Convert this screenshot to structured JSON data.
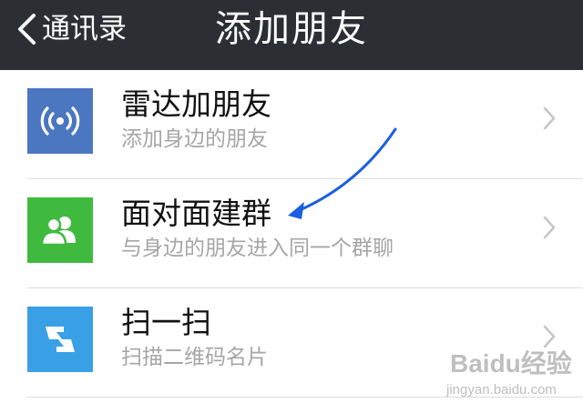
{
  "header": {
    "back_label": "通讯录",
    "title": "添加朋友"
  },
  "items": [
    {
      "icon": "radar-icon",
      "icon_bg": "#4b76c0",
      "title": "雷达加朋友",
      "subtitle": "添加身边的朋友"
    },
    {
      "icon": "group-people-icon",
      "icon_bg": "#3fba3f",
      "title": "面对面建群",
      "subtitle": "与身边的朋友进入同一个群聊"
    },
    {
      "icon": "scan-icon",
      "icon_bg": "#3aa0e6",
      "title": "扫一扫",
      "subtitle": "扫描二维码名片"
    }
  ],
  "colors": {
    "titlebar": "#2b2f33",
    "annotation_arrow": "#1a5fe0"
  },
  "watermark": {
    "logo": "Baidu经验",
    "url": "jingyan.baidu.com"
  }
}
